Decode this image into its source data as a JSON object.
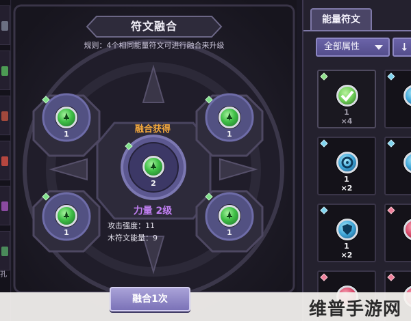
{
  "fusion": {
    "title": "符文融合",
    "rule": "规则：4个相同能量符文可进行融合来升级",
    "input_slots": [
      {
        "count": "1",
        "icon": "sword-rune-icon"
      },
      {
        "count": "1",
        "icon": "sword-rune-icon"
      },
      {
        "count": "1",
        "icon": "sword-rune-icon"
      },
      {
        "count": "1",
        "icon": "sword-rune-icon"
      }
    ],
    "result": {
      "label": "融合获得",
      "count": "2",
      "name": "力量 2级",
      "stat_1": "攻击强度：11",
      "stat_2": "木符文能量：9"
    },
    "button_label": "融合1次"
  },
  "inventory": {
    "tab_label": "能量符文",
    "filter_label": "全部属性",
    "sort_icon": "↓",
    "items": [
      {
        "level": "1",
        "qty": "×4",
        "orb": "check-rune-icon",
        "gem_color": "#8fe08a",
        "orb_color": "#6fcf58",
        "dim": true
      },
      {
        "level": "1",
        "qty": "×2",
        "orb": "swirl-rune-icon",
        "gem_color": "#7fd4ef",
        "orb_color": "#3fa6d8",
        "dim": false
      },
      {
        "level": "1",
        "qty": "×2",
        "orb": "shield-rune-icon",
        "gem_color": "#7fd4ef",
        "orb_color": "#3fa6d8",
        "dim": false
      }
    ],
    "partial_items": [
      {
        "gem_color": "#7fd4ef",
        "orb_color": "#3fa6d8"
      },
      {
        "gem_color": "#7fd4ef",
        "orb_color": "#3fa6d8"
      },
      {
        "gem_color": "#ef7f9a",
        "orb_color": "#d84a6a"
      },
      {
        "gem_color": "#ef7f9a",
        "orb_color": "#d84a6a"
      },
      {
        "gem_color": "#ef7f9a",
        "orb_color": "#d84a6a"
      }
    ]
  },
  "side_tabs": {
    "glyph": "孔"
  },
  "watermark": "维普手游网",
  "colors": {
    "accent_orange": "#f3a83c",
    "accent_purple": "#c07ff2",
    "rune_green": "#3fbf46",
    "panel_bg": "#1c1a25"
  }
}
